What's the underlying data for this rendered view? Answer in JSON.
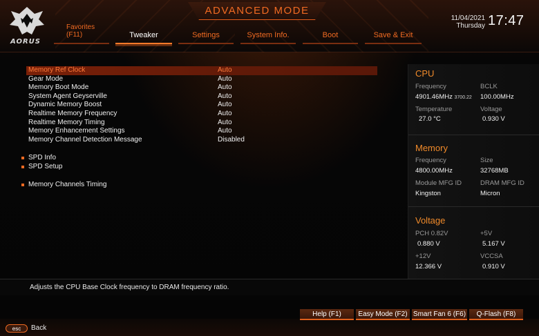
{
  "header": {
    "brand": "AORUS",
    "mode_title": "ADVANCED MODE",
    "date": "11/04/2021",
    "weekday": "Thursday",
    "time": "17:47"
  },
  "tabs": [
    {
      "label": "Favorites",
      "hotkey": "(F11)"
    },
    {
      "label": "Tweaker"
    },
    {
      "label": "Settings"
    },
    {
      "label": "System Info."
    },
    {
      "label": "Boot"
    },
    {
      "label": "Save & Exit"
    }
  ],
  "settings": [
    {
      "label": "Memory Ref Clock",
      "value": "Auto"
    },
    {
      "label": "Gear Mode",
      "value": "Auto"
    },
    {
      "label": "Memory Boot Mode",
      "value": "Auto"
    },
    {
      "label": "System Agent Geyserville",
      "value": "Auto"
    },
    {
      "label": "Dynamic Memory Boost",
      "value": "Auto"
    },
    {
      "label": "Realtime Memory Frequency",
      "value": "Auto"
    },
    {
      "label": "Realtime Memory Timing",
      "value": "Auto"
    },
    {
      "label": "Memory Enhancement Settings",
      "value": "Auto"
    },
    {
      "label": "Memory Channel Detection Message",
      "value": "Disabled"
    }
  ],
  "submenus": [
    {
      "label": "SPD Info"
    },
    {
      "label": "SPD Setup"
    },
    {
      "label": "Memory Channels Timing"
    }
  ],
  "cpu": {
    "title": "CPU",
    "frequency_label": "Frequency",
    "frequency_value": "4901.46MHz",
    "frequency_sub": "3700.22",
    "bclk_label": "BCLK",
    "bclk_value": "100.00MHz",
    "temperature_label": "Temperature",
    "temperature_value": "27.0 °C",
    "voltage_label": "Voltage",
    "voltage_value": "0.930 V"
  },
  "memory": {
    "title": "Memory",
    "frequency_label": "Frequency",
    "frequency_value": "4800.00MHz",
    "size_label": "Size",
    "size_value": "32768MB",
    "module_mfg_label": "Module MFG ID",
    "module_mfg_value": "Kingston",
    "dram_mfg_label": "DRAM MFG ID",
    "dram_mfg_value": "Micron"
  },
  "voltage": {
    "title": "Voltage",
    "pch_label": "PCH 0.82V",
    "pch_value": "0.880 V",
    "p5v_label": "+5V",
    "p5v_value": "5.167 V",
    "p12v_label": "+12V",
    "p12v_value": "12.366 V",
    "vccsa_label": "VCCSA",
    "vccsa_value": "0.910 V"
  },
  "help_text": "Adjusts the CPU Base Clock frequency to DRAM frequency ratio.",
  "buttons": {
    "help": "Help (F1)",
    "easy_mode": "Easy Mode (F2)",
    "smart_fan": "Smart Fan 6 (F6)",
    "qflash": "Q-Flash (F8)"
  },
  "esc": {
    "key": "esc",
    "label": "Back"
  },
  "colors": {
    "accent": "#f06a22",
    "selected_row": "#7a2008",
    "panel_title": "#f08a2a"
  }
}
